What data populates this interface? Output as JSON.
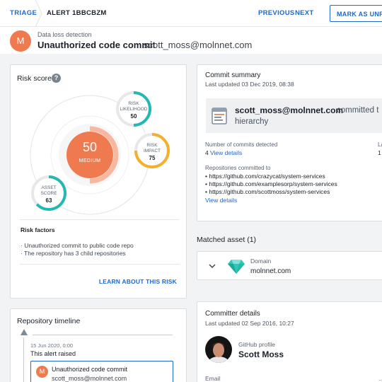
{
  "topbar": {
    "crumb_triage": "TRIAGE",
    "crumb_alert": "ALERT 1BBCBZM",
    "previous": "PREVIOUS",
    "next": "NEXT",
    "mark_button": "MARK AS UNREA"
  },
  "header": {
    "avatar_letter": "M",
    "category": "Data loss detection",
    "title": "Unauthorized code commit",
    "email": "scott_moss@molnnet.com"
  },
  "risk_score": {
    "title": "Risk score",
    "help_icon": "?",
    "score": "50",
    "score_level": "MEDIUM",
    "likelihood": {
      "label1": "RISK",
      "label2": "LIKELIHOOD",
      "value": "50",
      "fraction": 0.5
    },
    "impact": {
      "label1": "RISK",
      "label2": "IMPACT",
      "value": "75",
      "fraction": 0.75
    },
    "asset": {
      "label1": "ASSET",
      "label2": "SCORE",
      "value": "63",
      "fraction": 0.63
    },
    "factors_title": "Risk factors",
    "factors": [
      "Unauthorized commit to public code repo",
      "The repository has 3 child repositories"
    ],
    "learn_link": "LEARN ABOUT THIS RISK"
  },
  "timeline": {
    "title": "Repository timeline",
    "date": "15 Jun 2020, 0:00",
    "event": "This alert raised",
    "box_avatar": "M",
    "box_title": "Unauthorized code commit",
    "box_email": "scott_moss@molnnet.com"
  },
  "commit_summary": {
    "title": "Commit summary",
    "updated": "Last updated 03 Dec 2019, 08:38",
    "banner_email": "scott_moss@molnnet.com",
    "banner_rest": "committed t",
    "banner_line2": "hierarchy",
    "num_commits_label": "Number of commits detected",
    "num_commits": "4",
    "view_details": "View details",
    "col2_label": "La",
    "col2_value": "1",
    "repos_label": "Repositories committed to",
    "repos": [
      "https://github.com/crazycat/system-services",
      "https://github.com/examplesorp/system-services",
      "https://github.com/scottmoss/system-services"
    ],
    "view_details_2": "View details"
  },
  "matched_asset": {
    "title": "Matched asset (1)",
    "label": "Domain",
    "value": "molnnet.com"
  },
  "committer": {
    "title": "Committer details",
    "updated": "Last updated 02 Sep 2016, 10:27",
    "profile_label": "GitHub profile",
    "name": "Scott Moss",
    "email_label": "Email",
    "email_label_2": "..."
  },
  "colors": {
    "accent": "#2068c9",
    "orange": "#f07a4f",
    "teal": "#24b8b3",
    "yellow": "#f2b02d"
  }
}
